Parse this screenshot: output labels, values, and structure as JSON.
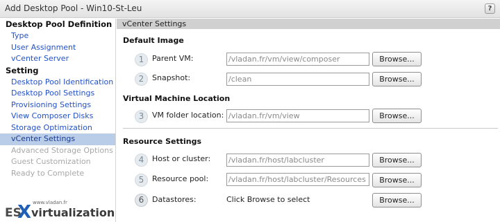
{
  "window": {
    "title": "Add Desktop Pool - Win10-St-Leu",
    "help_label": "?"
  },
  "sidebar": {
    "sections": [
      {
        "title": "Desktop Pool Definition",
        "items": [
          {
            "label": "Type",
            "state": "link"
          },
          {
            "label": "User Assignment",
            "state": "link"
          },
          {
            "label": "vCenter Server",
            "state": "link"
          }
        ]
      },
      {
        "title": "Setting",
        "items": [
          {
            "label": "Desktop Pool Identification",
            "state": "link"
          },
          {
            "label": "Desktop Pool Settings",
            "state": "link"
          },
          {
            "label": "Provisioning Settings",
            "state": "link"
          },
          {
            "label": "View Composer Disks",
            "state": "link"
          },
          {
            "label": "Storage Optimization",
            "state": "link"
          },
          {
            "label": "vCenter Settings",
            "state": "active"
          },
          {
            "label": "Advanced Storage Options",
            "state": "disabled"
          },
          {
            "label": "Guest Customization",
            "state": "disabled"
          },
          {
            "label": "Ready to Complete",
            "state": "disabled"
          }
        ]
      }
    ],
    "logo": {
      "small": "www.vladan.fr",
      "es": "ES",
      "x": "X",
      "rest": "virtualization"
    }
  },
  "main": {
    "header": "vCenter Settings",
    "sections": {
      "default_image": "Default Image",
      "vm_location": "Virtual Machine Location",
      "resource": "Resource Settings"
    },
    "rows": [
      {
        "num": "1",
        "label": "Parent VM:",
        "value": "/vladan.fr/vm/view/composer",
        "button": "Browse..."
      },
      {
        "num": "2",
        "label": "Snapshot:",
        "value": "/clean",
        "button": "Browse..."
      },
      {
        "num": "3",
        "label": "VM folder location:",
        "value": "/vladan.fr/vm/view",
        "button": "Browse..."
      },
      {
        "num": "4",
        "label": "Host or cluster:",
        "value": "/vladan.fr/host/labcluster",
        "button": "Browse..."
      },
      {
        "num": "5",
        "label": "Resource pool:",
        "value": "/vladan.fr/host/labcluster/Resources",
        "button": "Browse..."
      },
      {
        "num": "6",
        "label": "Datastores:",
        "value": "Click Browse to select",
        "button": "Browse..."
      }
    ]
  }
}
